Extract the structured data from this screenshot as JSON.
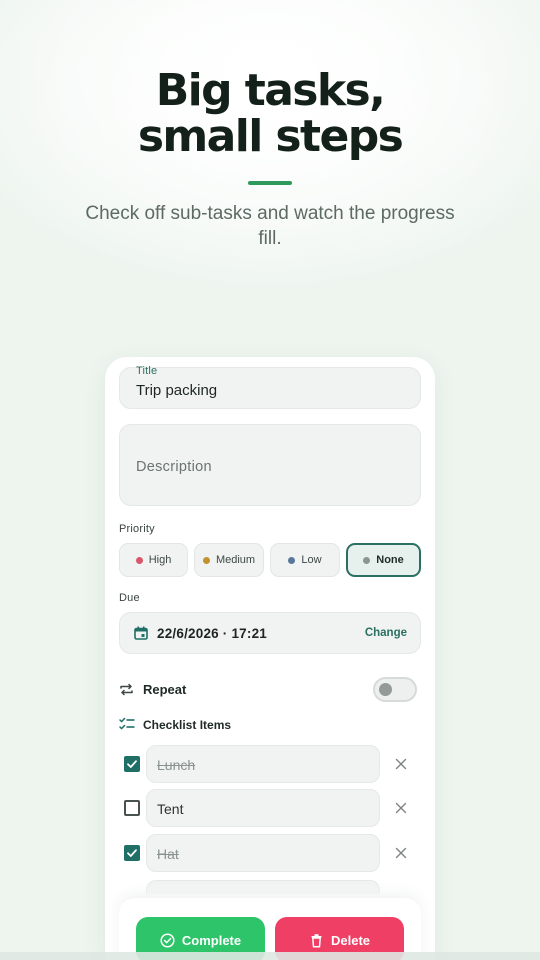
{
  "hero": {
    "headline_line1": "Big tasks,",
    "headline_line2": "small steps",
    "subtitle": "Check off sub-tasks and watch the progress fill."
  },
  "form": {
    "title_label": "Title",
    "title_value": "Trip packing",
    "description_placeholder": "Description",
    "priority_label": "Priority",
    "priorities": [
      {
        "label": "High",
        "color": "#d9566b",
        "selected": false
      },
      {
        "label": "Medium",
        "color": "#c1922e",
        "selected": false
      },
      {
        "label": "Low",
        "color": "#58779a",
        "selected": false
      },
      {
        "label": "None",
        "color": "#8c9490",
        "selected": true
      }
    ],
    "due_label": "Due",
    "due_value": "22/6/2026 · 17:21",
    "due_change": "Change",
    "repeat_label": "Repeat",
    "repeat_enabled": false,
    "checklist_label": "Checklist Items",
    "checklist": [
      {
        "text": "Lunch",
        "checked": true
      },
      {
        "text": "Tent",
        "checked": false
      },
      {
        "text": "Hat",
        "checked": true
      }
    ]
  },
  "actions": {
    "complete_label": "Complete",
    "delete_label": "Delete"
  },
  "colors": {
    "accent": "#2e9a5d",
    "primary_teal": "#1f6f66",
    "complete": "#2ec46a",
    "delete": "#ef3f65"
  }
}
